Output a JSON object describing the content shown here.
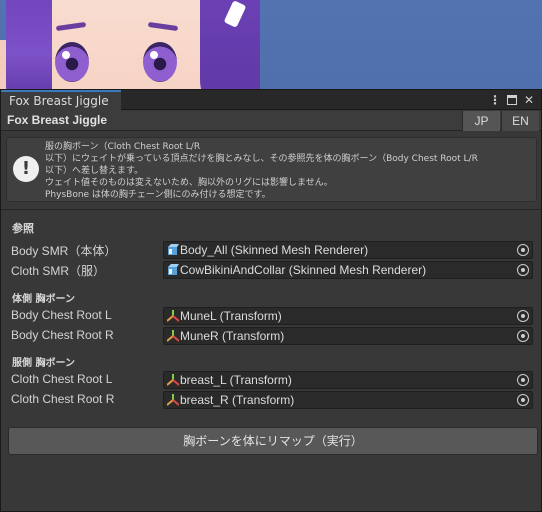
{
  "window": {
    "tab_label": "Fox Breast Jiggle",
    "title": "Fox Breast Jiggle",
    "icons": [
      "more-options-icon",
      "maximize-icon",
      "close-icon"
    ]
  },
  "language": {
    "jp_label": "JP",
    "en_label": "EN"
  },
  "help": {
    "icon": "info-icon",
    "lines": [
      "服の胸ボーン（Cloth Chest Root L/R",
      "以下）にウェイトが乗っている頂点だけを胸とみなし、その参照先を体の胸ボーン（Body Chest Root L/R",
      "以下）へ差し替えます。",
      "ウェイト値そのものは変えないため、胸以外のリグには影響しません。",
      "PhysBone は体の胸チェーン側にのみ付ける想定です。"
    ]
  },
  "sections": {
    "references": "参照",
    "body_chest": "体側 胸ボーン",
    "cloth_chest": "服側 胸ボーン"
  },
  "fields": [
    {
      "label": "Body SMR（本体）",
      "value": "Body_All (Skinned Mesh Renderer)",
      "icon": "skinned-mesh-icon"
    },
    {
      "label": "Cloth SMR（服）",
      "value": "CowBikiniAndCollar (Skinned Mesh Renderer)",
      "icon": "skinned-mesh-icon"
    },
    {
      "label": "Body Chest Root L",
      "value": "MuneL (Transform)",
      "icon": "transform-icon"
    },
    {
      "label": "Body Chest Root R",
      "value": "MuneR (Transform)",
      "icon": "transform-icon"
    },
    {
      "label": "Cloth Chest Root L",
      "value": "breast_L (Transform)",
      "icon": "transform-icon"
    },
    {
      "label": "Cloth Chest Root R",
      "value": "breast_R (Transform)",
      "icon": "transform-icon"
    }
  ],
  "action_button": "胸ボーンを体にリマップ（実行）",
  "colors": {
    "accent": "#3a79bb",
    "panel_bg": "#383838",
    "field_bg": "#2a2a2a",
    "button_bg": "#585858"
  }
}
